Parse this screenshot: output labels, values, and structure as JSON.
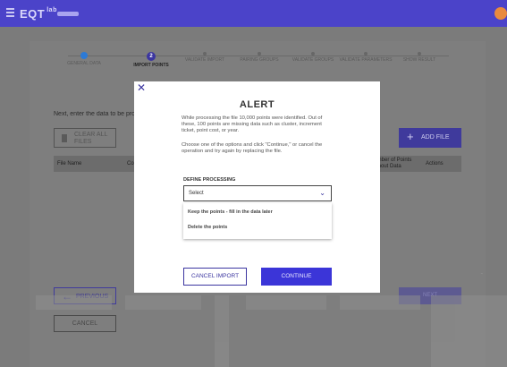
{
  "topbar": {
    "logo_text": "EQT",
    "logo_sub": "lab"
  },
  "stepper": {
    "steps": [
      {
        "label": "GENERAL DATA",
        "state": "done"
      },
      {
        "label": "IMPORT POINTS",
        "state": "active",
        "number": "2"
      },
      {
        "label": "VALIDATE IMPORT",
        "state": "pending"
      },
      {
        "label": "PAIRING GROUPS",
        "state": "pending"
      },
      {
        "label": "VALIDATE GROUPS",
        "state": "pending"
      },
      {
        "label": "VALIDATE PARAMETERS",
        "state": "pending"
      },
      {
        "label": "SHOW RESULT",
        "state": "pending"
      }
    ]
  },
  "main": {
    "intro": "Next, enter the data to be processed",
    "clear_all": "CLEAR ALL FILES",
    "add_file": "ADD FILE",
    "table_headers": {
      "file_name": "File Name",
      "co": "Co",
      "points_without_data": "Number of Points Without Data",
      "actions": "Actions"
    },
    "previous": "PREVIOUS",
    "next": "NEXT",
    "cancel": "CANCEL"
  },
  "modal": {
    "close": "✕",
    "title": "ALERT",
    "paragraph1": "While processing the file 10,000 points were identified. Out of these, 100 points are missing data such as cluster, increment ticket, point cost, or year.",
    "paragraph2": "Choose one of the options and click \"Continue,\" or cancel the operation and try again by replacing the file.",
    "define_label": "DEFINE PROCESSING",
    "select_value": "Select",
    "options": [
      "Keep the points - fill in the data later",
      "Delete the points"
    ],
    "cancel_import": "CANCEL IMPORT",
    "continue": "CONTINUE"
  },
  "colors": {
    "brand": "#4b43c9",
    "primary": "#3b35d8",
    "overlay": "#7b7b7b"
  }
}
